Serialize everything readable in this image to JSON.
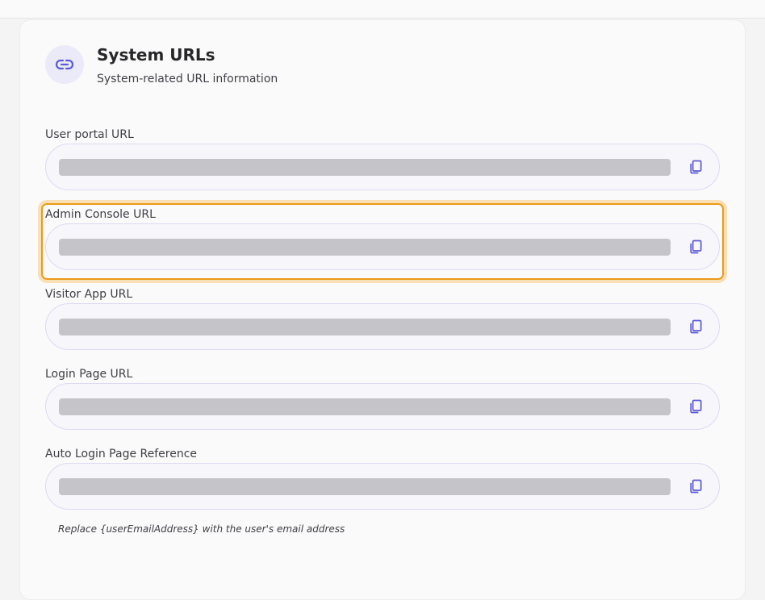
{
  "header": {
    "title": "System URLs",
    "subtitle": "System-related URL information",
    "icon": "link-icon"
  },
  "fields": [
    {
      "label": "User portal URL",
      "value_redacted": true,
      "copy_icon": "copy-icon"
    },
    {
      "label": "Admin Console URL",
      "value_redacted": true,
      "copy_icon": "copy-icon",
      "highlighted": true
    },
    {
      "label": "Visitor App URL",
      "value_redacted": true,
      "copy_icon": "copy-icon"
    },
    {
      "label": "Login Page URL",
      "value_redacted": true,
      "copy_icon": "copy-icon"
    },
    {
      "label": "Auto Login Page Reference",
      "value_redacted": true,
      "copy_icon": "copy-icon"
    }
  ],
  "hint": "Replace {userEmailAddress} with the user's email address",
  "colors": {
    "accent": "#5b5bd6",
    "highlight": "#ec9a18",
    "field_border": "#dcdaf3",
    "redacted": "#c4c4c9"
  }
}
